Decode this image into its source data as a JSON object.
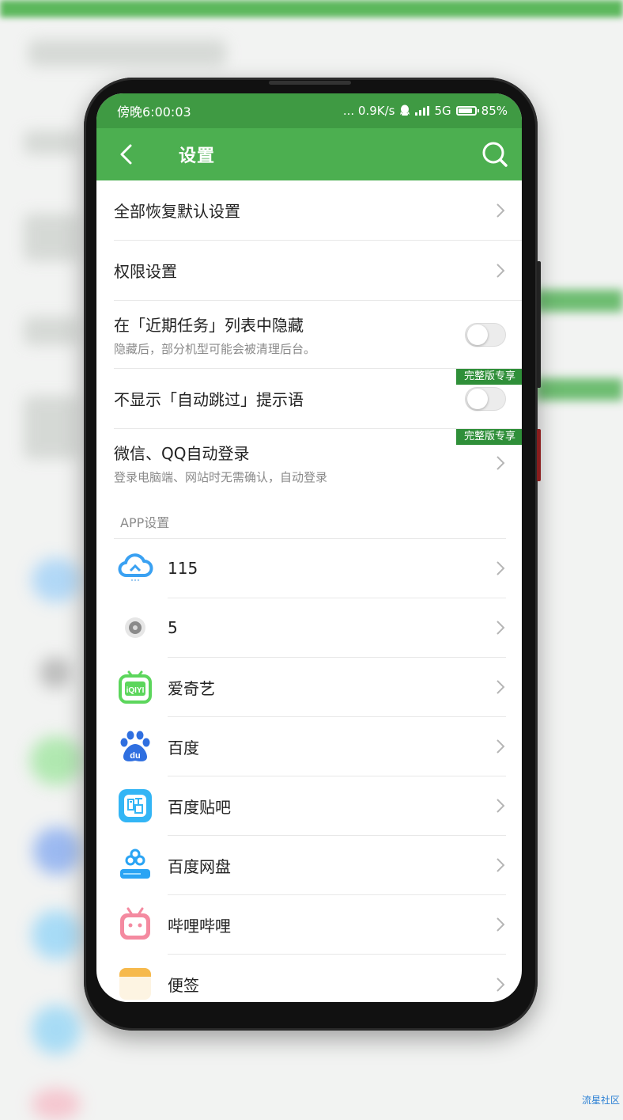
{
  "status_bar": {
    "time": "傍晚6:00:03",
    "net_speed": "... 0.9K/s",
    "network": "5G",
    "battery": "85%",
    "battery_level": 0.85
  },
  "app_bar": {
    "title": "设置"
  },
  "settings": {
    "reset": {
      "title": "全部恢复默认设置"
    },
    "permissions": {
      "title": "权限设置"
    },
    "hide_recent": {
      "title": "在「近期任务」列表中隐藏",
      "subtitle": "隐藏后，部分机型可能会被清理后台。",
      "enabled": false
    },
    "hide_tip": {
      "title": "不显示「自动跳过」提示语",
      "badge": "完整版专享",
      "enabled": false
    },
    "auto_login": {
      "title": "微信、QQ自动登录",
      "subtitle": "登录电脑端、网站时无需确认，自动登录",
      "badge": "完整版专享"
    }
  },
  "app_section": {
    "header": "APP设置",
    "apps": [
      {
        "name": "115",
        "icon": "cloud-115-icon",
        "color": "#3aa1f2"
      },
      {
        "name": "5",
        "icon": "speaker-dot-icon",
        "color": "#7a7a7a"
      },
      {
        "name": "爱奇艺",
        "icon": "iqiyi-tv-icon",
        "color": "#5cd65c"
      },
      {
        "name": "百度",
        "icon": "baidu-paw-icon",
        "color": "#2f6fe0"
      },
      {
        "name": "百度贴吧",
        "icon": "tieba-icon",
        "color": "#33b5f5"
      },
      {
        "name": "百度网盘",
        "icon": "baidu-netdisk-icon",
        "color": "#2aa4f4"
      },
      {
        "name": "哔哩哔哩",
        "icon": "bilibili-tv-icon",
        "color": "#f48aa0"
      },
      {
        "name": "便签",
        "icon": "notes-icon",
        "color": "#f6b94c"
      }
    ]
  },
  "watermark": "流星社区"
}
